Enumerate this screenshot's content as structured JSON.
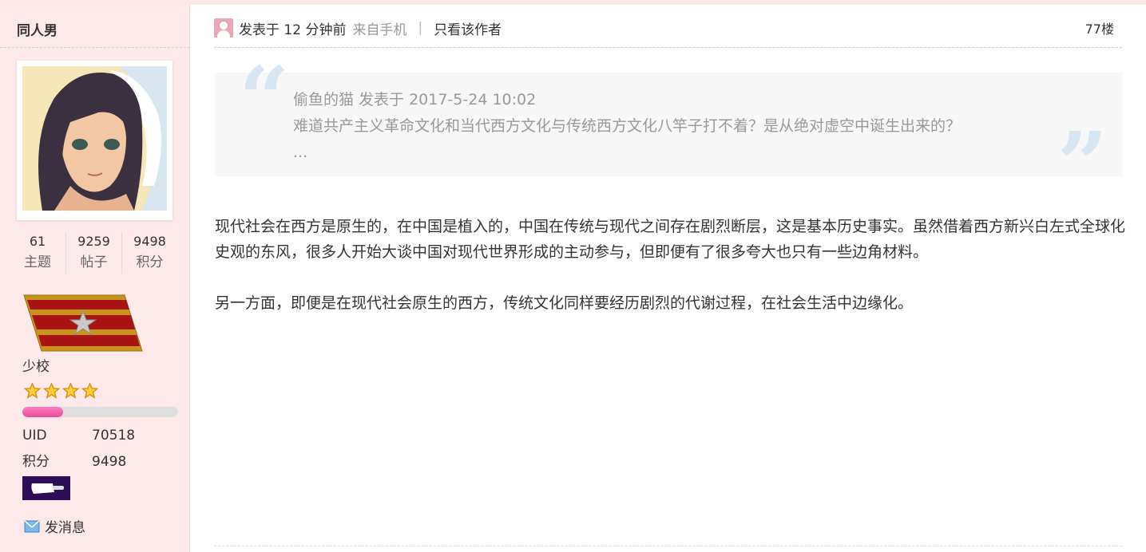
{
  "user": {
    "name": "同人男",
    "stats": [
      {
        "value": "61",
        "label": "主题"
      },
      {
        "value": "9259",
        "label": "帖子"
      },
      {
        "value": "9498",
        "label": "积分"
      }
    ],
    "rank_name": "少校",
    "star_count": 4,
    "level_progress_fraction": 0.26,
    "uid_label": "UID",
    "uid_value": "70518",
    "score_label": "积分",
    "score_value": "9498",
    "send_message": "发消息",
    "icons": {
      "message": "envelope-icon",
      "star": "star-icon",
      "rank": "rank-insignia-icon",
      "medal": "cleaver-medal-icon"
    }
  },
  "post": {
    "posted_label": "发表于",
    "posted_time": "12 分钟前",
    "from_label": "来自手机",
    "separator": "|",
    "only_author": "只看该作者",
    "floor": "77楼",
    "quote": {
      "author_line": "偷鱼的猫 发表于 2017-5-24 10:02",
      "text": "难道共产主义革命文化和当代西方文化与传统西方文化八竿子打不着？是从绝对虚空中诞生出来的？",
      "ellipsis": "..."
    },
    "paragraphs": [
      "现代社会在西方是原生的，在中国是植入的，中国在传统与现代之间存在剧烈断层，这是基本历史事实。虽然借着西方新兴白左式全球化史观的东风，很多人开始大谈中国对现代世界形成的主动参与，但即便有了很多夸大也只有一些边角材料。",
      "另一方面，即便是在现代社会原生的西方，传统文化同样要经历剧烈的代谢过程，在社会生活中边缘化。"
    ]
  },
  "colors": {
    "sidebar_bg": "#fde9e9",
    "quote_bg": "#f7f7f7",
    "progress": "#e8499c",
    "medal_bg": "#2e0d57"
  }
}
